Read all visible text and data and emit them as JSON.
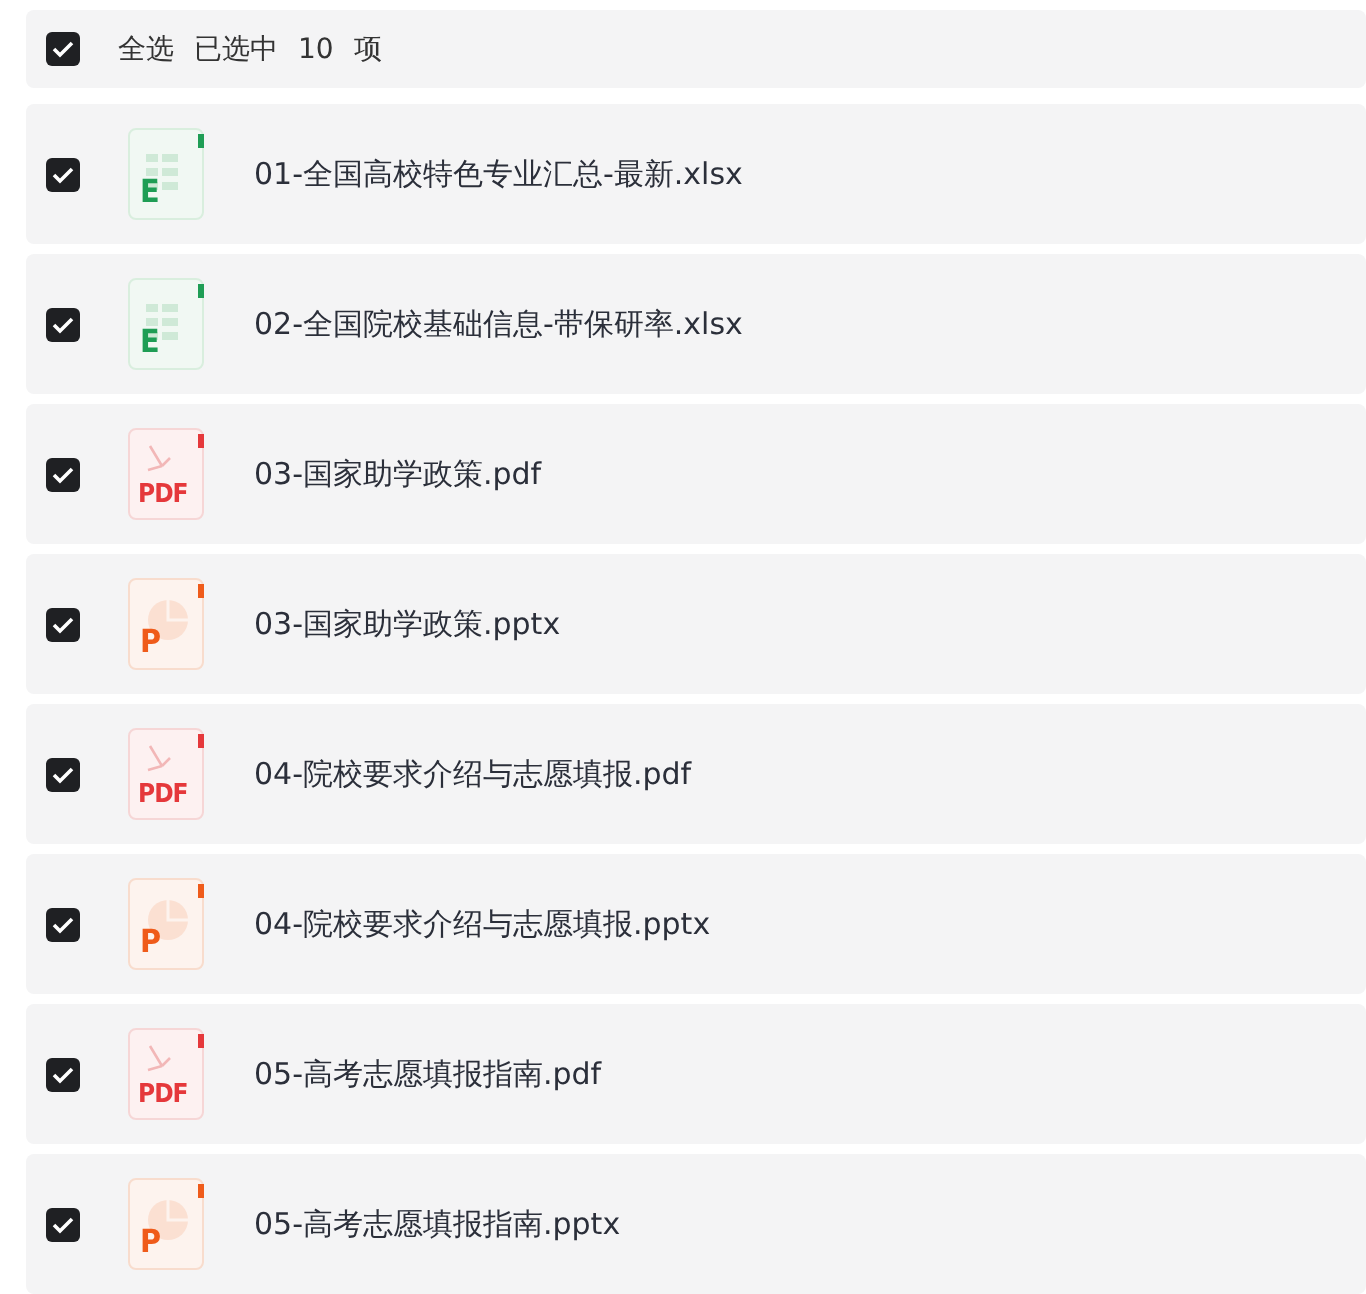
{
  "header": {
    "checked": true,
    "select_all": "全选",
    "selected_label": "已选中",
    "count": "10",
    "unit": "项"
  },
  "files": [
    {
      "kind": "xlsx",
      "icon_label": "E",
      "name": "01-全国高校特色专业汇总-最新.xlsx",
      "checked": true
    },
    {
      "kind": "xlsx",
      "icon_label": "E",
      "name": "02-全国院校基础信息-带保研率.xlsx",
      "checked": true
    },
    {
      "kind": "pdf",
      "icon_label": "PDF",
      "name": "03-国家助学政策.pdf",
      "checked": true
    },
    {
      "kind": "pptx",
      "icon_label": "P",
      "name": "03-国家助学政策.pptx",
      "checked": true
    },
    {
      "kind": "pdf",
      "icon_label": "PDF",
      "name": "04-院校要求介绍与志愿填报.pdf",
      "checked": true
    },
    {
      "kind": "pptx",
      "icon_label": "P",
      "name": "04-院校要求介绍与志愿填报.pptx",
      "checked": true
    },
    {
      "kind": "pdf",
      "icon_label": "PDF",
      "name": "05-高考志愿填报指南.pdf",
      "checked": true
    },
    {
      "kind": "pptx",
      "icon_label": "P",
      "name": "05-高考志愿填报指南.pptx",
      "checked": true
    }
  ]
}
